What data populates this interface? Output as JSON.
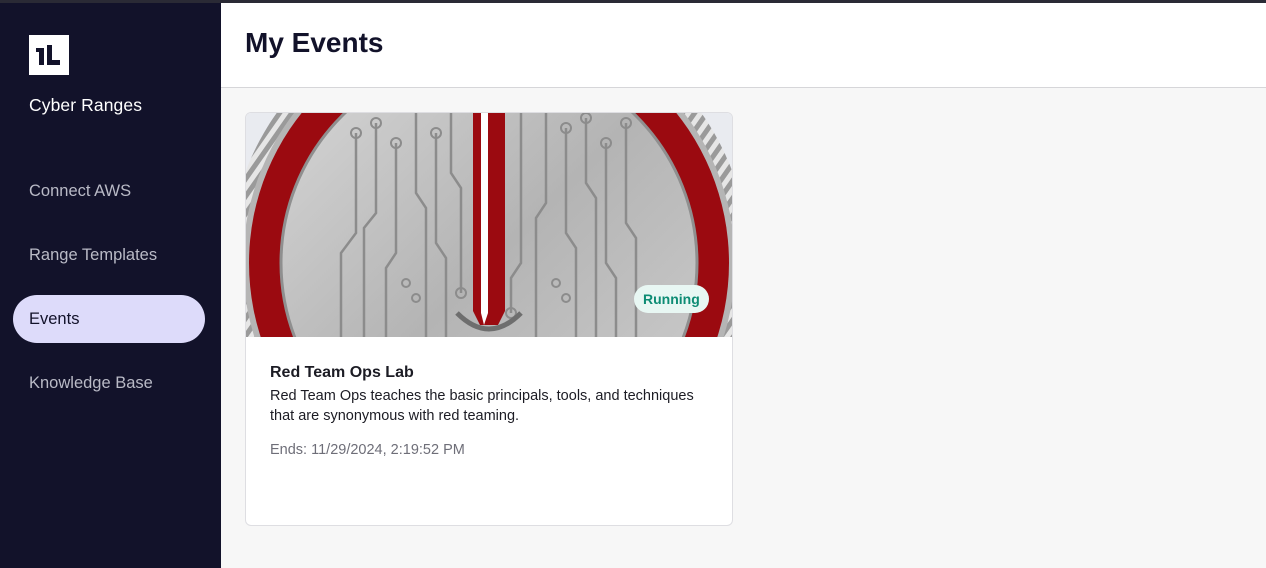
{
  "app": {
    "brand_name": "Cyber Ranges",
    "logo_icon": "il-logo-icon"
  },
  "sidebar": {
    "items": [
      {
        "label": "Connect AWS",
        "active": false
      },
      {
        "label": "Range Templates",
        "active": false
      },
      {
        "label": "Events",
        "active": true
      },
      {
        "label": "Knowledge Base",
        "active": false
      }
    ]
  },
  "header": {
    "title": "My Events"
  },
  "events": [
    {
      "title": "Red Team Ops Lab",
      "description": "Red Team Ops teaches the basic principals, tools, and techniques that are synonymous with red teaming.",
      "ends": "Ends: 11/29/2024, 2:19:52 PM",
      "status": "Running",
      "image_icon": "red-team-coin-image"
    }
  ],
  "colors": {
    "sidebar_bg": "#12122a",
    "active_nav_bg": "#dddbfa",
    "badge_bg": "#e8f7f3",
    "badge_text": "#0d8c74",
    "coin_red": "#9b0a10"
  }
}
